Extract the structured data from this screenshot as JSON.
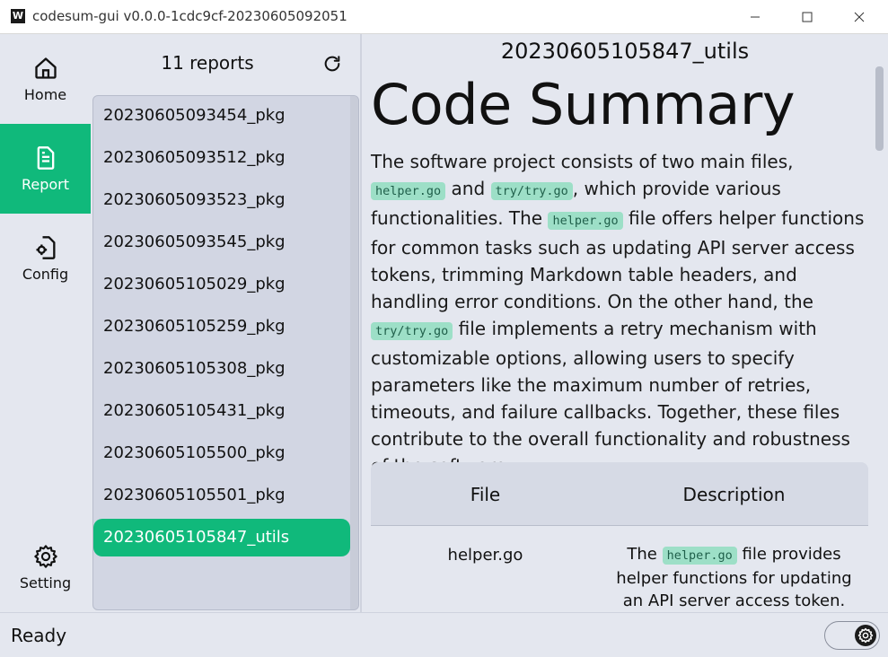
{
  "window": {
    "title": "codesum-gui v0.0.0-1cdc9cf-20230605092051",
    "app_icon": "W"
  },
  "nav": {
    "items": [
      {
        "label": "Home",
        "icon": "home-icon"
      },
      {
        "label": "Report",
        "icon": "document-icon",
        "active": true
      },
      {
        "label": "Config",
        "icon": "config-file-icon"
      }
    ],
    "setting": {
      "label": "Setting",
      "icon": "gear-icon"
    }
  },
  "reports": {
    "count_label": "11 reports",
    "items": [
      "20230605093454_pkg",
      "20230605093512_pkg",
      "20230605093523_pkg",
      "20230605093545_pkg",
      "20230605105029_pkg",
      "20230605105259_pkg",
      "20230605105308_pkg",
      "20230605105431_pkg",
      "20230605105500_pkg",
      "20230605105501_pkg",
      "20230605105847_utils"
    ],
    "selected": "20230605105847_utils"
  },
  "main": {
    "title": "20230605105847_utils",
    "heading": "Code Summary",
    "paragraph": {
      "t1": "The software project consists of two main files,",
      "c1": "helper.go",
      "t2": "and",
      "c2": "try/try.go",
      "t3": ", which provide various functionalities. The",
      "c3": "helper.go",
      "t4": "file offers helper functions for common tasks such as updating API server access tokens, trimming Markdown table headers, and handling error conditions. On the other hand, the",
      "c4": "try/try.go",
      "t5": "file implements a retry mechanism with customizable options, allowing users to specify parameters like the maximum number of retries, timeouts, and failure callbacks. Together, these files contribute to the overall functionality and robustness of the software."
    },
    "table": {
      "headers": [
        "File",
        "Description"
      ],
      "rows": [
        {
          "file": "helper.go",
          "desc_pre": "The",
          "desc_code": "helper.go",
          "desc_post": "file provides helper functions for updating an API server access token."
        }
      ]
    }
  },
  "status": {
    "text": "Ready",
    "theme_toggle_icon": "gear-icon"
  },
  "colors": {
    "accent": "#10b97b",
    "background": "#e4e7ef",
    "list_bg": "#d2d6e3",
    "code_bg": "#9ddfc7"
  }
}
